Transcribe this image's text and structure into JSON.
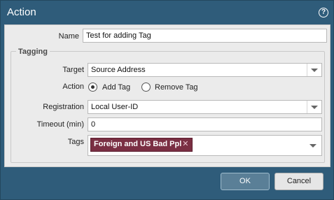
{
  "dialog": {
    "title": "Action",
    "help_icon": "help-icon",
    "help_glyph": "?"
  },
  "form": {
    "name_label": "Name",
    "name_value": "Test for adding Tag",
    "tagging_legend": "Tagging",
    "target_label": "Target",
    "target_value": "Source Address",
    "action_label": "Action",
    "action_options": [
      {
        "label": "Add Tag",
        "selected": true
      },
      {
        "label": "Remove Tag",
        "selected": false
      }
    ],
    "registration_label": "Registration",
    "registration_value": "Local User-ID",
    "timeout_label": "Timeout (min)",
    "timeout_value": "0",
    "tags_label": "Tags",
    "tags": [
      {
        "label": "Foreign and US Bad Ppl",
        "remove_glyph": "✕",
        "color": "#7a2f43"
      }
    ]
  },
  "buttons": {
    "ok_label": "OK",
    "cancel_label": "Cancel"
  },
  "colors": {
    "header": "#2f5c7a",
    "panel": "#ebebeb",
    "ok_button": "#5a7f97"
  }
}
